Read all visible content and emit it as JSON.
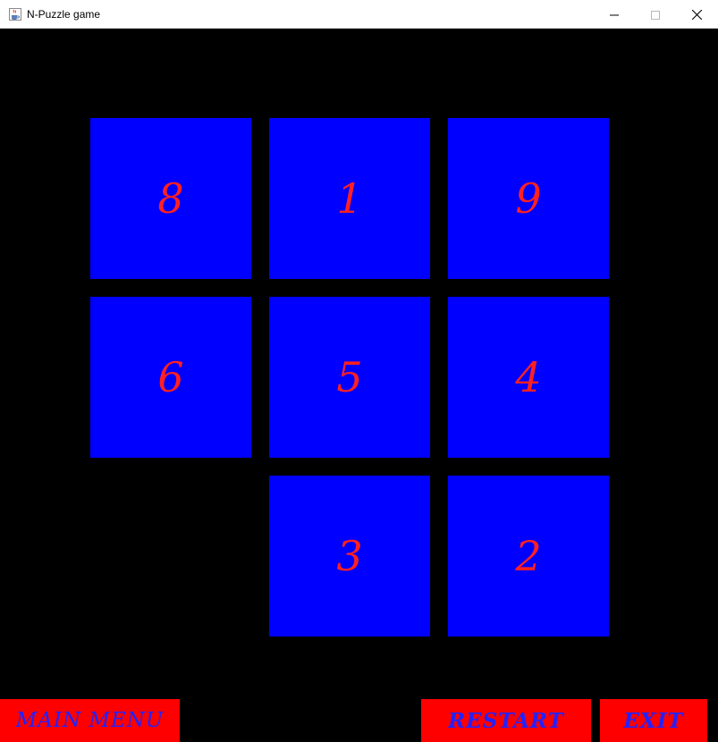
{
  "window": {
    "title": "N-Puzzle game"
  },
  "icons": {
    "app": "java-cup-icon",
    "minimize": "minimize-icon",
    "maximize": "maximize-icon",
    "close": "close-icon"
  },
  "colors": {
    "background": "#000000",
    "tile": "#0000ff",
    "tile_text": "#ff2020",
    "button": "#ff0000",
    "button_text": "#2222ff"
  },
  "board": {
    "rows": 3,
    "cols": 3,
    "tiles": [
      "8",
      "1",
      "9",
      "6",
      "5",
      "4",
      "",
      "3",
      "2"
    ]
  },
  "buttons": {
    "main_menu": "MAIN MENU",
    "restart": "RESTART",
    "exit": "EXIT"
  }
}
